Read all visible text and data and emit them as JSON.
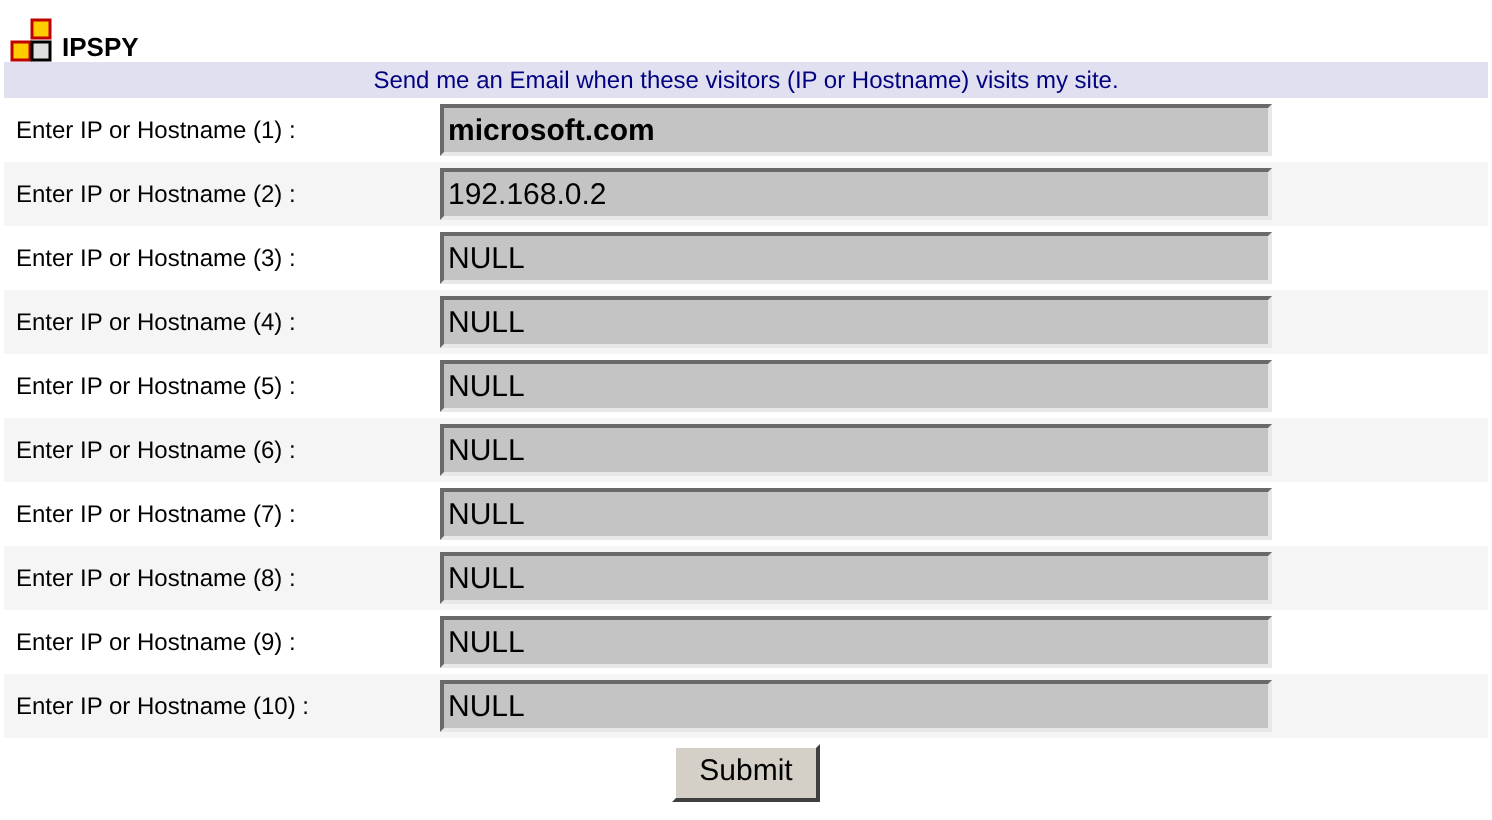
{
  "title": "IPSPY",
  "banner": "Send me an Email when these visitors (IP or Hostname) visits my site.",
  "fields": [
    {
      "label": "Enter IP or Hostname (1) :",
      "value": "microsoft.com"
    },
    {
      "label": "Enter IP or Hostname (2) :",
      "value": "192.168.0.2"
    },
    {
      "label": "Enter IP or Hostname (3) :",
      "value": "NULL"
    },
    {
      "label": "Enter IP or Hostname (4) :",
      "value": "NULL"
    },
    {
      "label": "Enter IP or Hostname (5) :",
      "value": "NULL"
    },
    {
      "label": "Enter IP or Hostname (6) :",
      "value": "NULL"
    },
    {
      "label": "Enter IP or Hostname (7) :",
      "value": "NULL"
    },
    {
      "label": "Enter IP or Hostname (8) :",
      "value": "NULL"
    },
    {
      "label": "Enter IP or Hostname (9) :",
      "value": "NULL"
    },
    {
      "label": "Enter IP or Hostname (10) :",
      "value": "NULL"
    }
  ],
  "submit": "Submit"
}
